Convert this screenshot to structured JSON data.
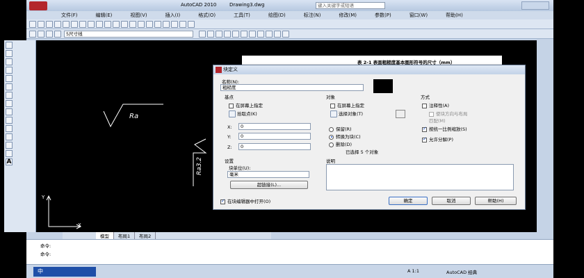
{
  "app": {
    "title": "AutoCAD 2010",
    "document": "Drawing3.dwg",
    "search_placeholder": "键入关键字或短语"
  },
  "menu": [
    "文件(F)",
    "编辑(E)",
    "视图(V)",
    "插入(I)",
    "格式(O)",
    "工具(T)",
    "绘图(D)",
    "标注(N)",
    "修改(M)",
    "参数(P)",
    "窗口(W)",
    "帮助(H)"
  ],
  "toolbar": {
    "dimstyle": "5尺寸线"
  },
  "drawing": {
    "table_caption": "表 2-1  表面粗糙度基本图形符号的尺寸（mm）",
    "symbol1": "Ra",
    "symbol2": "Ra3.2",
    "axis_x": "X",
    "axis_y": "Y"
  },
  "tabs": [
    "模型",
    "布局1",
    "布局2"
  ],
  "dialog": {
    "title": "块定义",
    "name_label": "名称(N):",
    "name_value": "粗糙度",
    "base": {
      "title": "基点",
      "on_screen": "在屏幕上指定",
      "pick": "拾取点(K)",
      "x_label": "X:",
      "x": "0",
      "y_label": "Y:",
      "y": "0",
      "z_label": "Z:",
      "z": "0"
    },
    "objects": {
      "title": "对象",
      "on_screen": "在屏幕上指定",
      "select": "选择对象(T)",
      "retain": "保留(R)",
      "convert": "转换为块(C)",
      "delete": "删除(D)",
      "selected": "已选择 5 个对象"
    },
    "behavior": {
      "title": "方式",
      "annotative": "注释性(A)",
      "match": "使块方向与布局\n匹配(M)",
      "uniform": "按统一比例缩放(S)",
      "explode": "允许分解(P)"
    },
    "settings": {
      "title": "设置",
      "unit_label": "块单位(U):",
      "unit": "毫米",
      "hyperlink": "超链接(L)..."
    },
    "description": {
      "title": "说明"
    },
    "open_editor": "在块编辑器中打开(O)",
    "ok": "确定",
    "cancel": "取消",
    "help": "帮助(H)"
  },
  "command": {
    "line1": "命令:",
    "line2": "命令:"
  },
  "status": {
    "ime": "中",
    "zoom": "A 1:1",
    "workspace": "AutoCAD 经典"
  }
}
